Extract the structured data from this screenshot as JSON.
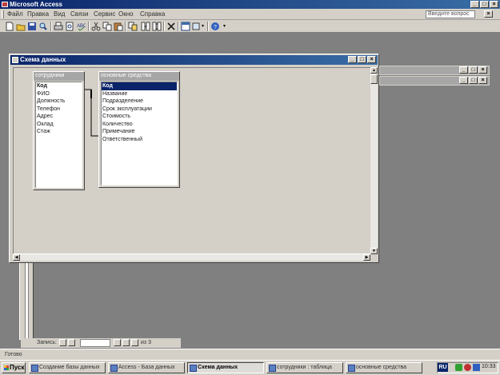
{
  "app": {
    "title": "Microsoft Access"
  },
  "menu": {
    "items": [
      "Файл",
      "Правка",
      "Вид",
      "Связи",
      "Сервис",
      "Окно",
      "Справка"
    ],
    "help_placeholder": "Введите вопрос"
  },
  "toolbar": {
    "icons": [
      "new-icon",
      "open-icon",
      "save-icon",
      "search-icon",
      "print-icon",
      "print-preview-icon",
      "spelling-icon",
      "cut-icon",
      "copy-icon",
      "paste-icon",
      "show-table-icon",
      "direct-relationships-icon",
      "all-relationships-icon",
      "delete-icon",
      "database-window-icon",
      "new-object-icon",
      "help-icon"
    ]
  },
  "relations_window": {
    "title": "Схема данных",
    "tables": [
      {
        "name": "сотрудники",
        "fields": [
          "Код",
          "ФИО",
          "Должность",
          "Телефон",
          "Адрес",
          "Оклад",
          "Стаж"
        ],
        "key_field": 0
      },
      {
        "name": "основные средства",
        "fields": [
          "Код",
          "Название",
          "Подразделение",
          "Срок эксплуатации",
          "Стоимость",
          "Количество",
          "Примечание",
          "Ответственный"
        ],
        "selected_field": 0
      }
    ]
  },
  "record_nav": {
    "label": "Запись:",
    "total": "из 3"
  },
  "status": {
    "text": "Готово"
  },
  "taskbar": {
    "start": "Пуск",
    "tasks": [
      {
        "label": "Создание базы данных",
        "active": false
      },
      {
        "label": "Access - База данных",
        "active": false
      },
      {
        "label": "Схема данных",
        "active": true
      },
      {
        "label": "сотрудники : таблица",
        "active": false
      },
      {
        "label": "основные средства",
        "active": false
      }
    ],
    "lang": "RU",
    "clock": "10:33"
  }
}
